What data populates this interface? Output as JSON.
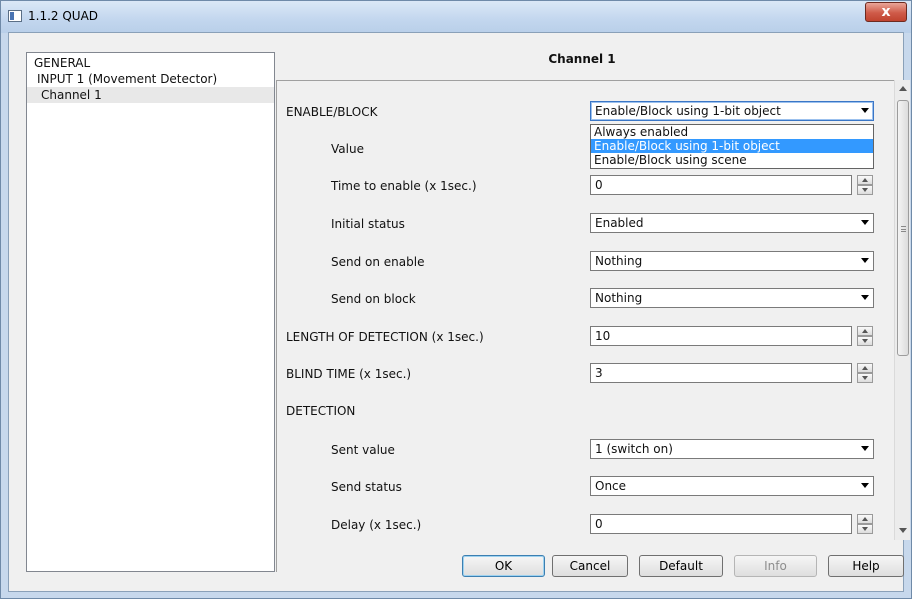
{
  "window": {
    "title": "1.1.2 QUAD",
    "close_glyph": "x"
  },
  "tree": {
    "items": [
      {
        "label": "GENERAL"
      },
      {
        "label": "INPUT 1 (Movement Detector)"
      },
      {
        "label": "Channel 1"
      }
    ]
  },
  "panel": {
    "title": "Channel 1",
    "rows": {
      "enable_block": {
        "label": "ENABLE/BLOCK",
        "value": "Enable/Block using 1-bit object"
      },
      "value": {
        "label": "Value"
      },
      "time_to_enable": {
        "label": "Time to enable (x 1sec.)",
        "value": "0"
      },
      "initial_status": {
        "label": "Initial status",
        "value": "Enabled"
      },
      "send_on_enable": {
        "label": "Send on enable",
        "value": "Nothing"
      },
      "send_on_block": {
        "label": "Send on block",
        "value": "Nothing"
      },
      "length_of_detection": {
        "label": "LENGTH OF DETECTION (x 1sec.)",
        "value": "10"
      },
      "blind_time": {
        "label": "BLIND TIME (x 1sec.)",
        "value": "3"
      },
      "detection": {
        "label": "DETECTION"
      },
      "sent_value": {
        "label": "Sent value",
        "value": "1 (switch on)"
      },
      "send_status": {
        "label": "Send status",
        "value": "Once"
      },
      "delay": {
        "label": "Delay (x 1sec.)",
        "value": "0"
      }
    },
    "dropdown_options": [
      "Always enabled",
      "Enable/Block using 1-bit object",
      "Enable/Block using scene"
    ],
    "dropdown_selected_index": 1
  },
  "buttons": {
    "ok": "OK",
    "cancel": "Cancel",
    "default": "Default",
    "info": "Info",
    "help": "Help"
  },
  "colors": {
    "selection": "#3399ff",
    "title_bar": "#c2d6ee",
    "close_button": "#cf5b49"
  }
}
